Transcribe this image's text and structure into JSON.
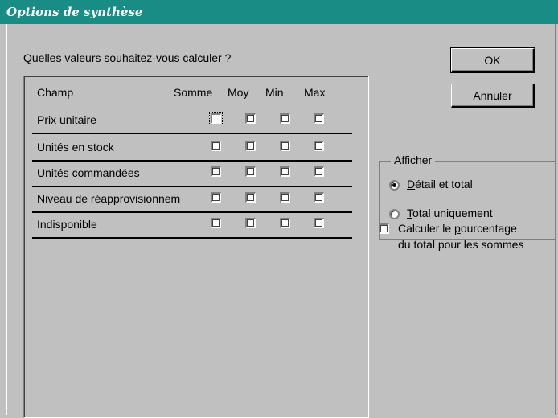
{
  "window": {
    "title": "Options de synthèse"
  },
  "question": "Quelles valeurs souhaitez-vous calculer ?",
  "grid": {
    "headers": {
      "champ": "Champ",
      "somme": "Somme",
      "moy": "Moy",
      "min": "Min",
      "max": "Max"
    },
    "rows": [
      {
        "label": "Prix unitaire"
      },
      {
        "label": "Unités en stock"
      },
      {
        "label": "Unités commandées"
      },
      {
        "label": "Niveau de réapprovisionnem"
      },
      {
        "label": "Indisponible"
      }
    ]
  },
  "buttons": {
    "ok": "OK",
    "cancel": "Annuler"
  },
  "show_group": {
    "title": "Afficher",
    "options": [
      {
        "first": "D",
        "rest": "étail et total",
        "selected": true
      },
      {
        "first": "T",
        "rest": "otal uniquement",
        "selected": false
      }
    ]
  },
  "percent_option": {
    "line1_pre": "Calculer le ",
    "line1_ul": "p",
    "line1_post": "ourcentage",
    "line2": "du total pour les sommes",
    "checked": false
  }
}
